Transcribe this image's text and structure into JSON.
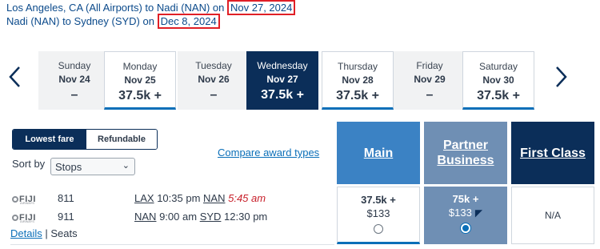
{
  "header": {
    "route1_text": "Los Angeles, CA (All Airports) to Nadi (NAN) on",
    "route1_date": "Nov 27, 2024",
    "route2_text": "Nadi (NAN) to Sydney (SYD) on",
    "route2_date": "Dec 8, 2024"
  },
  "calendar": {
    "days": [
      {
        "day": "Sunday",
        "date": "Nov 24",
        "price": "–"
      },
      {
        "day": "Monday",
        "date": "Nov 25",
        "price": "37.5k +"
      },
      {
        "day": "Tuesday",
        "date": "Nov 26",
        "price": "–"
      },
      {
        "day": "Wednesday",
        "date": "Nov 27",
        "price": "37.5k +"
      },
      {
        "day": "Thursday",
        "date": "Nov 28",
        "price": "37.5k +"
      },
      {
        "day": "Friday",
        "date": "Nov 29",
        "price": "–"
      },
      {
        "day": "Saturday",
        "date": "Nov 30",
        "price": "37.5k +"
      }
    ]
  },
  "filters": {
    "lowest_fare": "Lowest fare",
    "refundable": "Refundable",
    "sort_by_label": "Sort by",
    "sort_value": "Stops",
    "compare_link": "Compare award types"
  },
  "cabins": {
    "main": "Main",
    "partner_line1": "Partner",
    "partner_line2": "Business",
    "first": "First Class"
  },
  "flight": {
    "segments": [
      {
        "airline": "FIJI",
        "airline_sub": "AIRWAYS",
        "number": "811",
        "from": "LAX",
        "dep": "10:35 pm",
        "to": "NAN",
        "arr": "5:45 am"
      },
      {
        "airline": "FIJI",
        "airline_sub": "AIRWAYS",
        "number": "911",
        "from": "NAN",
        "dep": "9:00 am",
        "to": "SYD",
        "arr": "12:30 pm"
      }
    ],
    "details_link": "Details",
    "separator": "|",
    "seats_link": "Seats",
    "fares": {
      "main": {
        "miles": "37.5k +",
        "tax": "$133"
      },
      "partner": {
        "miles": "75k +",
        "tax": "$133"
      },
      "first": {
        "value": "N/A"
      }
    }
  },
  "colors": {
    "navy": "#0b2e59",
    "main_blue": "#3b82c4",
    "partner_blue": "#6f8fb4",
    "link_blue": "#0b6fb8",
    "highlight_red": "#e01f26"
  }
}
